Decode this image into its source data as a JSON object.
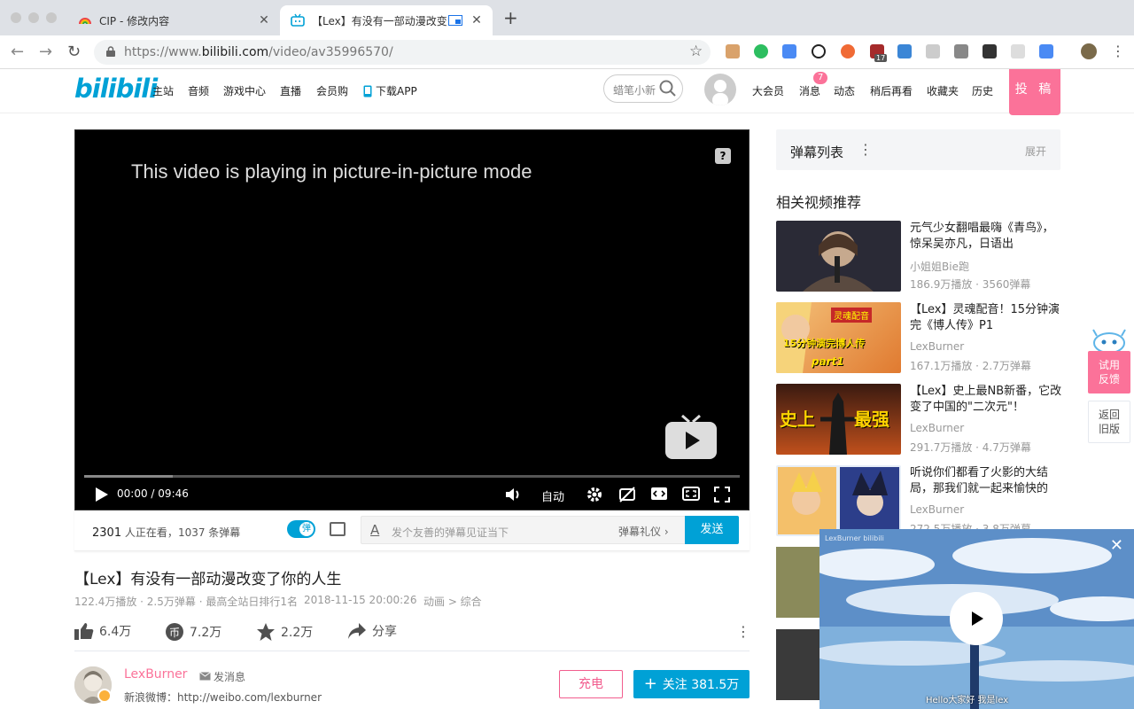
{
  "browser": {
    "tabs": [
      {
        "title": "CIP - 修改内容",
        "active": false
      },
      {
        "title": "【Lex】有没有一部动漫改变",
        "active": true
      }
    ],
    "url_prefix": "https://www.",
    "url_domain": "bilibili.com",
    "url_path": "/video/av35996570/",
    "extension_badge": "17"
  },
  "site": {
    "logo": "bilibili",
    "nav": [
      "主站",
      "音频",
      "游戏中心",
      "直播",
      "会员购",
      "下载APP"
    ],
    "search_placeholder": "蜡笔小新",
    "right_nav": [
      "大会员",
      "消息",
      "动态",
      "稍后再看",
      "收藏夹",
      "历史"
    ],
    "message_badge": "7",
    "post_label": "投 稿"
  },
  "player": {
    "pip_message": "This video is playing in picture-in-picture mode",
    "help_icon": "?",
    "current_time": "00:00",
    "separator": "/",
    "duration": "09:46",
    "quality": "自动",
    "progress_fraction": 0.135
  },
  "danmaku_bar": {
    "viewers": "2301",
    "viewers_suffix": "人正在看，",
    "count_text": "1037 条弹幕",
    "toggle_label": "弹",
    "input_placeholder": "发个友善的弹幕见证当下",
    "etiquette": "弹幕礼仪",
    "send_label": "发送"
  },
  "video": {
    "title": "【Lex】有没有一部动漫改变了你的人生",
    "stats": "122.4万播放 · 2.5万弹幕 · 最高全站日排行1名",
    "date": "2018-11-15 20:00:26",
    "category": "动画 > 综合",
    "likes": "6.4万",
    "coins": "7.2万",
    "favorites": "2.2万",
    "share": "分享"
  },
  "uploader": {
    "name": "LexBurner",
    "message_label": "发消息",
    "bio": "新浪微博：http://weibo.com/lexburner",
    "charge_label": "充电",
    "follow_label": "关注 381.5万"
  },
  "sidebar": {
    "danmaku_list_title": "弹幕列表",
    "expand_label": "展开",
    "related_heading": "相关视频推荐",
    "recommendations": [
      {
        "title": "元气少女翻唱最嗨《青鸟》，惊呆吴亦凡，日语出",
        "up": "小姐姐Bie跑",
        "stats": "186.9万播放 · 3560弹幕"
      },
      {
        "title": "【Lex】灵魂配音！15分钟演完《博人传》P1",
        "up": "LexBurner",
        "stats": "167.1万播放 · 2.7万弹幕",
        "thumb_text1": "灵魂配音",
        "thumb_text2": "15分钟演完博人传",
        "thumb_text3": "part1"
      },
      {
        "title": "【Lex】史上最NB新番，它改变了中国的\"二次元\"！",
        "up": "LexBurner",
        "stats": "291.7万播放 · 4.7万弹幕",
        "thumb_text1": "史上",
        "thumb_text2": "最强"
      },
      {
        "title": "听说你们都看了火影的大结局，那我们就一起来愉快的",
        "up": "LexBurner",
        "stats": "272.5万播放 · 3.8万弹幕"
      }
    ]
  },
  "float_buttons": {
    "feedback": [
      "试用",
      "反馈"
    ],
    "old_version": [
      "返回",
      "旧版"
    ]
  },
  "pip_window": {
    "channel_label": "LexBurner bilibili",
    "subtitle": "Hello大家好 我是lex"
  },
  "colors": {
    "brand_blue": "#00a1d6",
    "brand_pink": "#fb7299"
  }
}
